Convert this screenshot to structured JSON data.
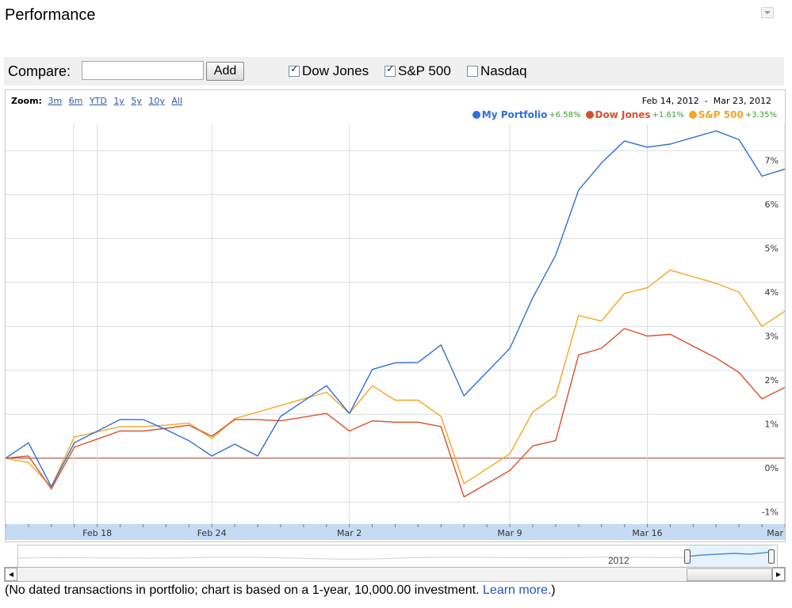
{
  "page": {
    "title": "Performance"
  },
  "toolbar": {
    "compare_label": "Compare:",
    "compare_value": "",
    "add_label": "Add",
    "checkboxes": [
      {
        "label": "Dow Jones",
        "checked": true
      },
      {
        "label": "S&P 500",
        "checked": true
      },
      {
        "label": "Nasdaq",
        "checked": false
      }
    ]
  },
  "zoom": {
    "label": "Zoom:",
    "options": [
      "3m",
      "6m",
      "YTD",
      "1y",
      "5y",
      "10y",
      "All"
    ]
  },
  "date_range": {
    "start": "Feb 14, 2012",
    "separator": "-",
    "end": "Mar 23, 2012"
  },
  "navigator": {
    "year_label": "2012"
  },
  "footnote": {
    "text": "(No dated transactions in portfolio; chart is based on a 1-year, 10,000.00 investment.",
    "link": "Learn more.",
    "close": ")"
  },
  "colors": {
    "portfolio": "#2f6fd6",
    "dow": "#d8502a",
    "sp": "#f6a623",
    "zero_line": "#9c3a2e",
    "grid": "#d7dde6",
    "axis_band": "#c5dbf3"
  },
  "chart_data": {
    "type": "line",
    "x": [
      "Feb 14",
      "Feb 15",
      "Feb 16",
      "Feb 17",
      "Feb 18",
      "Feb 20",
      "Feb 21",
      "Feb 22",
      "Feb 23",
      "Feb 24",
      "Feb 25",
      "Feb 27",
      "Feb 28",
      "Feb 29",
      "Mar 1",
      "Mar 2",
      "Mar 3",
      "Mar 4",
      "Mar 5",
      "Mar 6",
      "Mar 7",
      "Mar 8",
      "Mar 9",
      "Mar 10",
      "Mar 12",
      "Mar 13",
      "Mar 14",
      "Mar 15",
      "Mar 16",
      "Mar 17",
      "Mar 19",
      "Mar 20",
      "Mar 21",
      "Mar 22",
      "Mar 23"
    ],
    "series": [
      {
        "name": "My Portfolio",
        "change": "+6.58%",
        "color": "#2f6fd6",
        "values": [
          0,
          0.35,
          -0.65,
          0.35,
          0.88,
          0.88,
          0.65,
          0.4,
          0.05,
          0.32,
          0.05,
          0.95,
          1.65,
          1.02,
          2.02,
          2.17,
          2.18,
          2.58,
          1.42,
          2.5,
          3.65,
          4.62,
          6.1,
          6.72,
          7.22,
          7.08,
          7.15,
          7.45,
          7.25,
          6.42,
          6.58
        ]
      },
      {
        "name": "Dow Jones",
        "change": "+1.61%",
        "color": "#d8502a",
        "values": [
          0,
          0.05,
          -0.7,
          0.25,
          0.62,
          0.62,
          0.68,
          0.75,
          0.5,
          0.88,
          0.88,
          0.85,
          1.02,
          0.62,
          0.85,
          0.82,
          0.82,
          0.72,
          -0.88,
          -0.28,
          0.28,
          0.4,
          2.35,
          2.5,
          2.95,
          2.78,
          2.82,
          2.28,
          1.95,
          1.35,
          1.61
        ]
      },
      {
        "name": "S&P 500",
        "change": "+3.35%",
        "color": "#f6a623",
        "values": [
          0,
          -0.1,
          -0.65,
          0.48,
          0.72,
          0.72,
          0.75,
          0.8,
          0.45,
          0.9,
          1.05,
          1.2,
          1.5,
          1.02,
          1.65,
          1.32,
          1.32,
          0.95,
          -0.58,
          0.1,
          1.05,
          1.42,
          3.25,
          3.12,
          3.75,
          3.88,
          4.28,
          3.98,
          3.78,
          3.0,
          3.35
        ]
      }
    ],
    "x_ticks": [
      "Feb 18",
      "Feb 24",
      "Mar 2",
      "Mar 9",
      "Mar 16",
      "Mar"
    ],
    "y_ticks": [
      "-1%",
      "0%",
      "1%",
      "2%",
      "3%",
      "4%",
      "5%",
      "6%",
      "7%"
    ],
    "y_values": [
      -1,
      0,
      1,
      2,
      3,
      4,
      5,
      6,
      7
    ],
    "ylim": [
      -1.5,
      7.6
    ],
    "grid": true,
    "legend": "top-right"
  }
}
